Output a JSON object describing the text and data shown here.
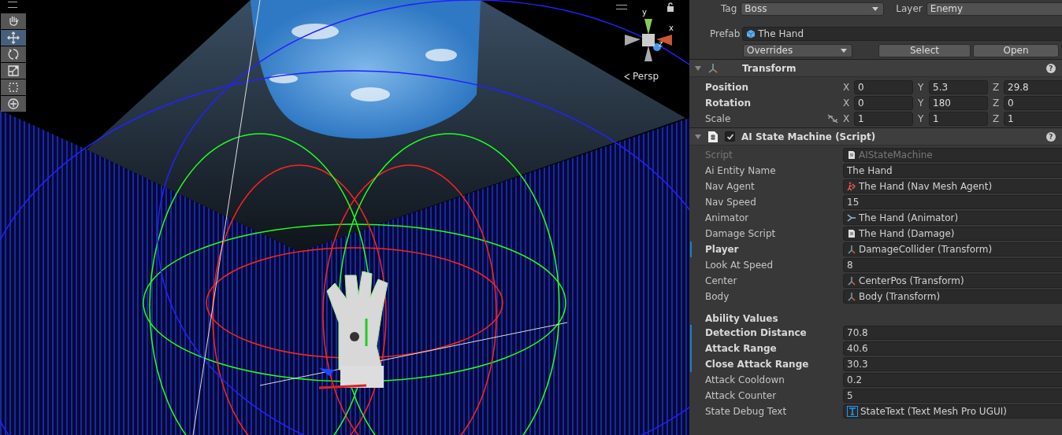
{
  "scene_view": {
    "tools": [
      {
        "kind": "hand",
        "selected": false
      },
      {
        "kind": "move",
        "selected": true
      },
      {
        "kind": "rotate",
        "selected": false
      },
      {
        "kind": "scale",
        "selected": false
      },
      {
        "kind": "rect",
        "selected": false
      },
      {
        "kind": "transform",
        "selected": false
      }
    ],
    "gizmo": {
      "y": "y",
      "x": "x",
      "z": "z",
      "projection": "Persp"
    }
  },
  "inspector": {
    "tag": {
      "label": "Tag",
      "value": "Boss"
    },
    "layer": {
      "label": "Layer",
      "value": "Enemy"
    },
    "prefab": {
      "label": "Prefab",
      "value": "The Hand",
      "overrides": "Overrides",
      "buttons": [
        "Select",
        "Open"
      ]
    },
    "transform": {
      "title": "Transform",
      "help": "?",
      "rows": [
        {
          "label": "Position",
          "overridden": true,
          "linked": false,
          "values": [
            {
              "axis": "X",
              "value": "0"
            },
            {
              "axis": "Y",
              "value": "5.3"
            },
            {
              "axis": "Z",
              "value": "29.8"
            }
          ]
        },
        {
          "label": "Rotation",
          "overridden": true,
          "linked": false,
          "values": [
            {
              "axis": "X",
              "value": "0"
            },
            {
              "axis": "Y",
              "value": "180"
            },
            {
              "axis": "Z",
              "value": "0"
            }
          ]
        },
        {
          "label": "Scale",
          "overridden": false,
          "linked": true,
          "values": [
            {
              "axis": "X",
              "value": "1"
            },
            {
              "axis": "Y",
              "value": "1"
            },
            {
              "axis": "Z",
              "value": "1"
            }
          ]
        }
      ]
    },
    "script": {
      "title": "AI State Machine (Script)",
      "help": "?",
      "enabled": true,
      "fields": [
        {
          "kind": "script",
          "label": "Script",
          "value": "AIStateMachine",
          "disabled": true,
          "overridden": false
        },
        {
          "kind": "text",
          "label": "Ai Entity Name",
          "value": "The Hand",
          "disabled": false,
          "overridden": false
        },
        {
          "kind": "navagent",
          "label": "Nav Agent",
          "value": "The Hand (Nav Mesh Agent)",
          "disabled": false,
          "overridden": false
        },
        {
          "kind": "text",
          "label": "Nav Speed",
          "value": "15",
          "disabled": false,
          "overridden": false
        },
        {
          "kind": "animator",
          "label": "Animator",
          "value": "The Hand (Animator)",
          "disabled": false,
          "overridden": false
        },
        {
          "kind": "script",
          "label": "Damage Script",
          "value": "The Hand (Damage)",
          "disabled": false,
          "overridden": false
        },
        {
          "kind": "transform",
          "label": "Player",
          "value": "DamageCollider (Transform)",
          "disabled": false,
          "overridden": true
        },
        {
          "kind": "text",
          "label": "Look At Speed",
          "value": "8",
          "disabled": false,
          "overridden": false
        },
        {
          "kind": "transform",
          "label": "Center",
          "value": "CenterPos (Transform)",
          "disabled": false,
          "overridden": false
        },
        {
          "kind": "transform",
          "label": "Body",
          "value": "Body (Transform)",
          "disabled": false,
          "overridden": false
        },
        {
          "kind": "header",
          "label": "Ability Values"
        },
        {
          "kind": "text",
          "label": "Detection Distance",
          "value": "70.8",
          "disabled": false,
          "overridden": true
        },
        {
          "kind": "text",
          "label": "Attack Range",
          "value": "40.6",
          "disabled": false,
          "overridden": true
        },
        {
          "kind": "text",
          "label": "Close Attack Range",
          "value": "30.3",
          "disabled": false,
          "overridden": true
        },
        {
          "kind": "text",
          "label": "Attack Cooldown",
          "value": "0.2",
          "disabled": false,
          "overridden": false
        },
        {
          "kind": "text",
          "label": "Attack Counter",
          "value": "5",
          "disabled": false,
          "overridden": false
        },
        {
          "kind": "tmptext",
          "label": "State Debug Text",
          "value": "StateText (Text Mesh Pro UGUI)",
          "disabled": false,
          "overridden": false
        }
      ]
    }
  }
}
